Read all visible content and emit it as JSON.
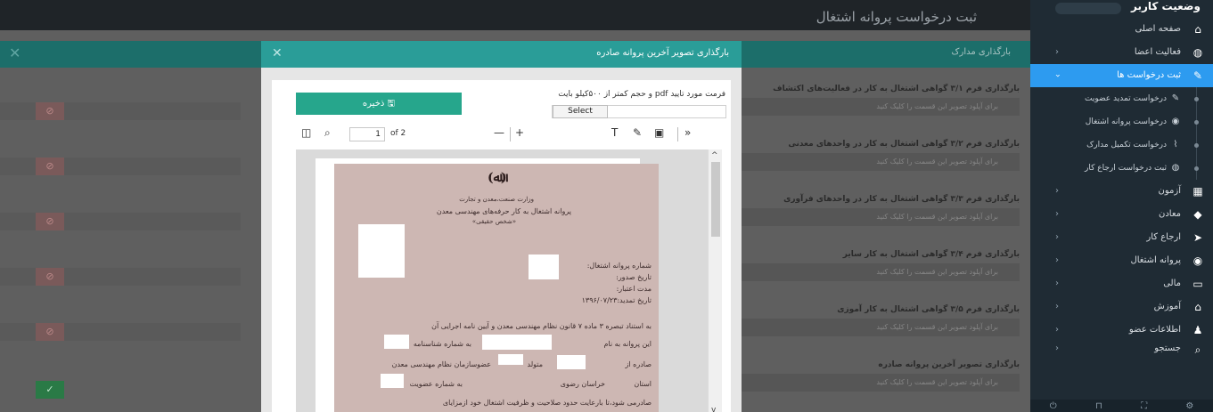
{
  "sidebar": {
    "user": "وضعیت کاربر",
    "items": [
      {
        "label": "صفحه اصلی",
        "icon": "home-icon",
        "glyph": "⌂"
      },
      {
        "label": "فعالیت اعضا",
        "icon": "palette-icon",
        "glyph": "◍"
      },
      {
        "label": "ثبت درخواست ها",
        "icon": "edit-icon",
        "glyph": "✎"
      },
      {
        "label": "آزمون",
        "icon": "calendar-icon",
        "glyph": "▦"
      },
      {
        "label": "معادن",
        "icon": "gem-icon",
        "glyph": "◆"
      },
      {
        "label": "ارجاع کار",
        "icon": "send-icon",
        "glyph": "➤"
      },
      {
        "label": "پروانه اشتغال",
        "icon": "eye-icon",
        "glyph": "◉"
      },
      {
        "label": "مالی",
        "icon": "card-icon",
        "glyph": "▭"
      },
      {
        "label": "آموزش",
        "icon": "graduation-icon",
        "glyph": "⌂"
      },
      {
        "label": "اطلاعات عضو",
        "icon": "users-icon",
        "glyph": "♟"
      },
      {
        "label": "جستجو",
        "icon": "search-icon",
        "glyph": "⌕"
      }
    ],
    "subitems": [
      {
        "label": "درخواست تمدید عضویت",
        "icon": "edit-icon",
        "glyph": "✎"
      },
      {
        "label": "درخواست پروانه اشتغال",
        "icon": "eye-icon",
        "glyph": "◉"
      },
      {
        "label": "درخواست تکمیل مدارک",
        "icon": "paperclip-icon",
        "glyph": "⌇"
      },
      {
        "label": "ثبت درخواست ارجاع کار",
        "icon": "palette-icon",
        "glyph": "◍"
      }
    ]
  },
  "page": {
    "title": "ثبت درخواست پروانه اشتغال",
    "section": "بارگذاری مدارک",
    "hint": "برای آپلود تصویر این قسمت را کلیک کنید",
    "items": [
      "بارگذاری فرم ۳/۱ گواهی اشتغال به کار در فعالیت‌های اکتشاف",
      "بارگذاری فرم ۳/۲ گواهی اشتغال به کار در واحدهای معدنی",
      "بارگذاری فرم ۳/۳ گواهی اشتغال به کار در واحدهای فرآوری",
      "بارگذاری فرم ۳/۴ گواهی اشتغال به کار سایر",
      "بارگذاری فرم ۳/۵ گواهی اشتغال به کار آموزی",
      "بارگذاری تصویر آخرین پروانه صادره"
    ]
  },
  "modal": {
    "title": "بارگذاری تصویر آخرین پروانه صادره",
    "hint": "فرمت مورد تایید pdf و حجم کمتر از ۵۰۰کیلو بایت",
    "select_label": "Select",
    "save_label": "ذخیره",
    "viewer": {
      "page_current": "1",
      "page_total": "of 2"
    }
  },
  "document": {
    "ministry": "وزارت صنعت،معدن و تجارت",
    "title": "پروانه اشتغال به کار حرفه‌های مهندسی معدن",
    "subtitle": "«شخص حقیقی»",
    "license_number": "شماره پروانه اشتغال:",
    "issue_date": "تاریخ صدور:",
    "validity": "مدت اعتبار:",
    "renewal_date": "تاریخ تمدید:۱۳۹۶/۰۷/۲۳",
    "para1": "به استناد تبصره ۳ ماده ۷ قانون نظام مهندسی معدن و آیین نامه اجرایی آن",
    "para2": "این پروانه به نام",
    "para2b": "به شماره شناسنامه",
    "para3": "صادره از",
    "para3b": "متولد",
    "para3c": "عضوسازمان نظام مهندسی معدن",
    "para4": "استان",
    "para4b": "خراسان رضوی",
    "para4c": "به شماره عضویت",
    "para5": "صادرمی شود،تا بارعایت حدود صلاحیت و ظرفیت اشتغال خود ازمزایای"
  }
}
